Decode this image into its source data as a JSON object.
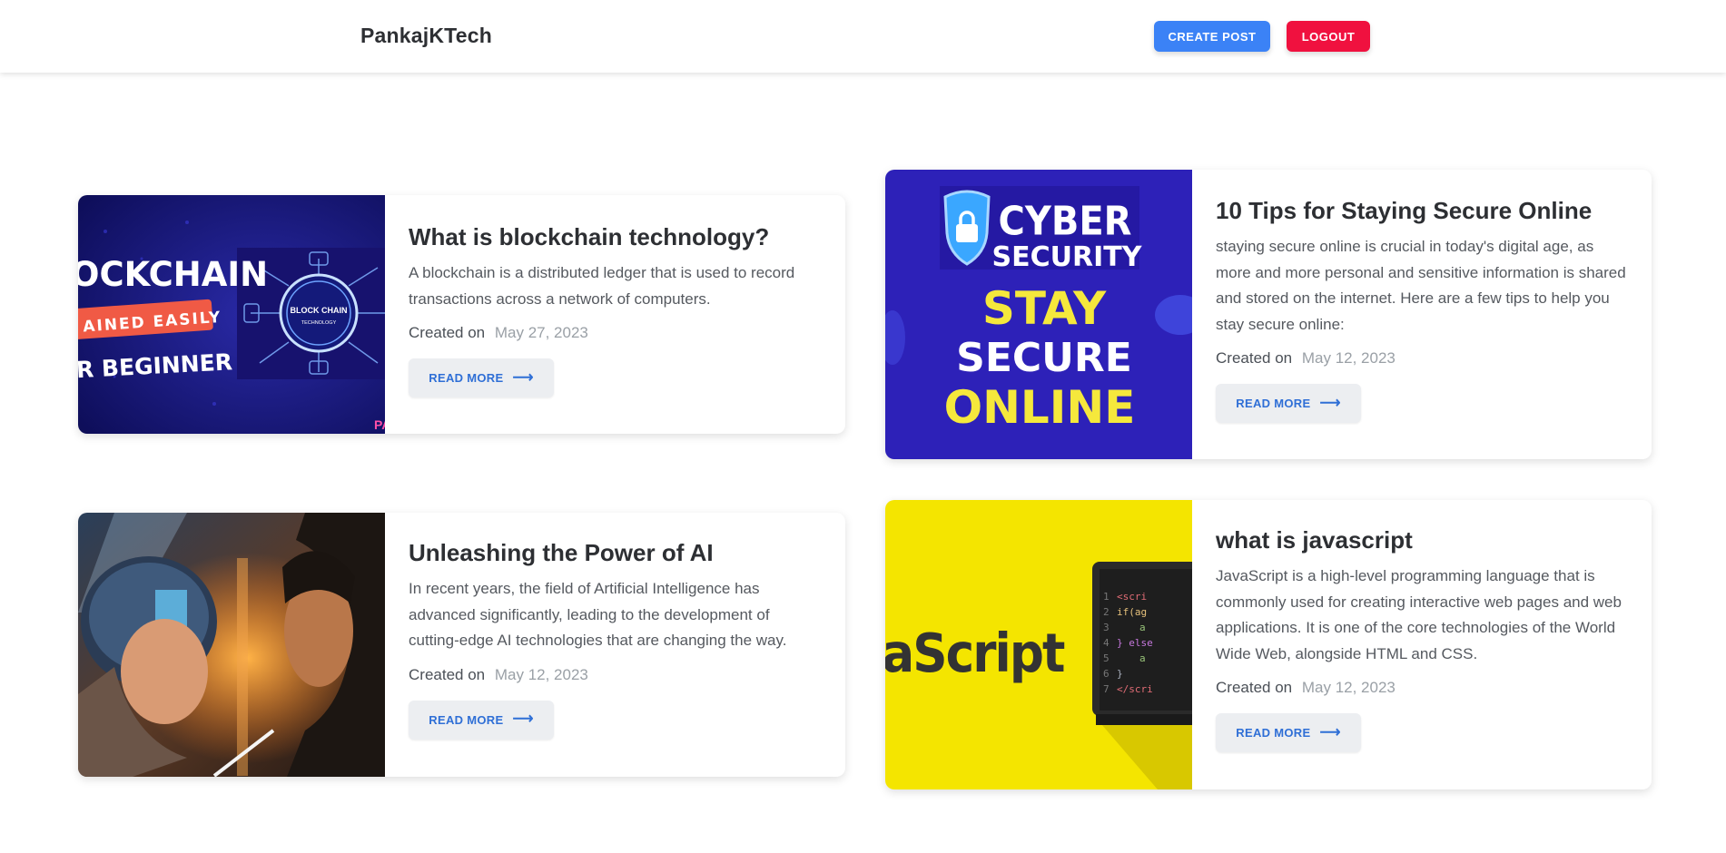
{
  "header": {
    "brand": "PankajKTech",
    "create_label": "CREATE POST",
    "logout_label": "LOGOUT"
  },
  "read_more_label": "READ MORE",
  "arrow_glyph": "⟶",
  "posts": [
    {
      "title": "What is blockchain technology?",
      "description": "A blockchain is a distributed ledger that is used to record transactions across a network of computers.",
      "created_label": "Created on",
      "date": "May 27, 2023",
      "image": {
        "icon": "blockchain-image",
        "lines": [
          "OCKCHAIN",
          "AINED EASILY",
          "R BEGINNER"
        ],
        "badge": "BLOCK CHAIN",
        "badge_sub": "TECHNOLOGY"
      }
    },
    {
      "title": "10 Tips for Staying Secure Online",
      "description": "staying secure online is crucial in today's digital age, as more and more personal and sensitive information is shared and stored on the internet. Here are a few tips to help you stay secure online:",
      "created_label": "Created on",
      "date": "May 12, 2023",
      "image": {
        "icon": "cyber-security-image",
        "lines": [
          "CYBER",
          "SECURITY",
          "STAY",
          "SECURE",
          "ONLINE"
        ]
      }
    },
    {
      "title": "Unleashing the Power of AI",
      "description": "In recent years, the field of Artificial Intelligence has advanced significantly, leading to the development of cutting-edge AI technologies that are changing the way.",
      "created_label": "Created on",
      "date": "May 12, 2023",
      "image": {
        "icon": "ai-robot-image"
      }
    },
    {
      "title": "what is javascript",
      "description": "JavaScript is a high-level programming language that is commonly used for creating interactive web pages and web applications. It is one of the core technologies of the World Wide Web, alongside HTML and CSS.",
      "created_label": "Created on",
      "date": "May 12, 2023",
      "image": {
        "icon": "javascript-image",
        "lines": [
          "aScript"
        ],
        "code": [
          "<scri",
          "if(ag",
          "a",
          "} else",
          "a",
          "}",
          "</scri"
        ]
      }
    }
  ]
}
